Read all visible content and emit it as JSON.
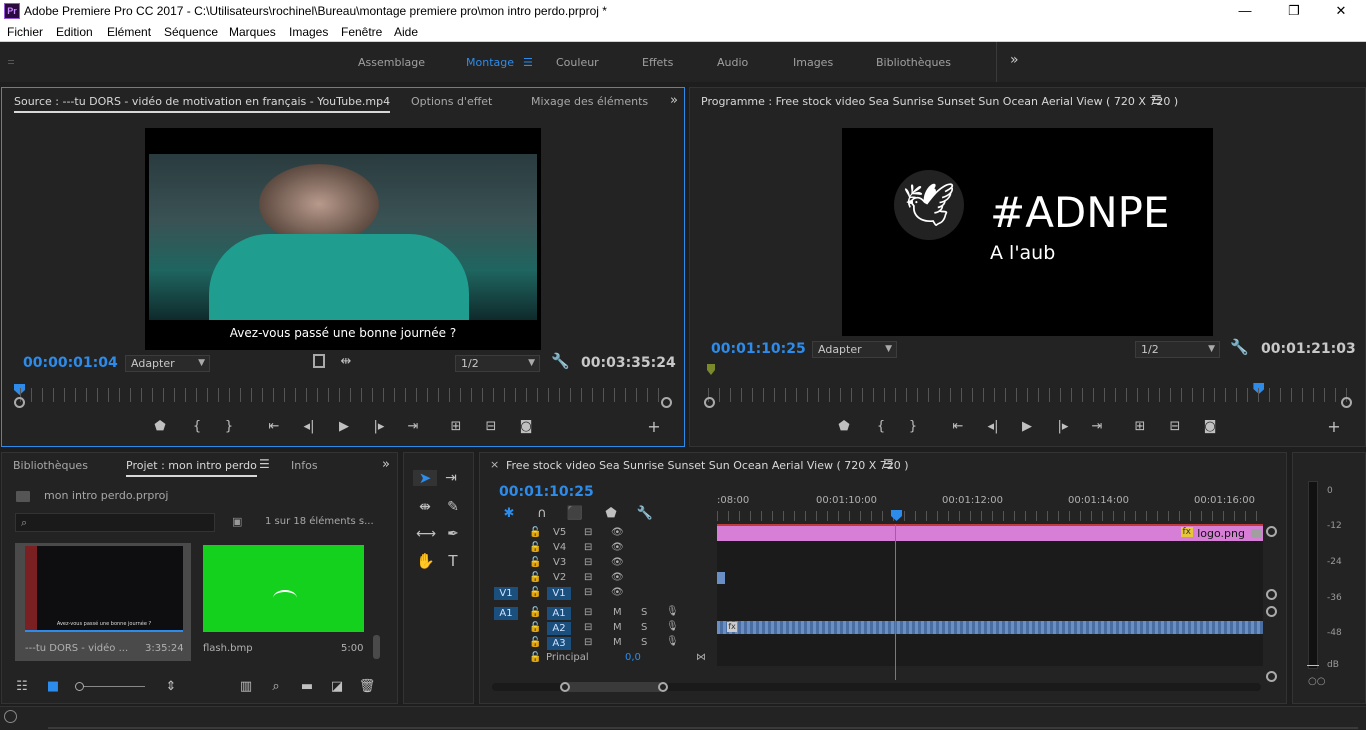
{
  "window": {
    "title": "Adobe Premiere Pro CC 2017 - C:\\Utilisateurs\\rochinel\\Bureau\\montage premiere pro\\mon intro perdo.prproj *",
    "app_icon": "Pr",
    "minimize": "—",
    "maximize": "❐",
    "close": "✕"
  },
  "menu": [
    "Fichier",
    "Edition",
    "Elément",
    "Séquence",
    "Marques",
    "Images",
    "Fenêtre",
    "Aide"
  ],
  "workspaces": {
    "items": [
      "Assemblage",
      "Montage",
      "Couleur",
      "Effets",
      "Audio",
      "Images",
      "Bibliothèques"
    ],
    "active": "Montage",
    "more": "»",
    "active_color": "#2d8ceb"
  },
  "source": {
    "tabs": [
      "Source : ---tu DORS - vidéo de motivation en français - YouTube.mp4",
      "Options d'effet",
      "Mixage des éléments a"
    ],
    "subtitle": "Avez-vous passé une bonne journée ?",
    "timecode": "00:00:01:04",
    "zoom": "Adapter",
    "resolution": "1/2",
    "duration": "00:03:35:24",
    "playhead_fraction": 0.0
  },
  "program": {
    "title": "Programme : Free stock video Sea Sunrise Sunset Sun Ocean Aerial View ( 720 X 720 )",
    "logo_text": "#ADNPE",
    "logo_sub": "A l'aub",
    "timecode": "00:01:10:25",
    "zoom": "Adapter",
    "resolution": "1/2",
    "duration": "00:01:21:03",
    "playhead_fraction": 0.86
  },
  "project": {
    "tabs": [
      "Bibliothèques",
      "Projet : mon intro perdo",
      "Infos"
    ],
    "file": "mon intro perdo.prproj",
    "search_placeholder": "",
    "count": "1 sur 18 éléments s...",
    "items": [
      {
        "name": "---tu DORS - vidéo ...",
        "duration": "3:35:24",
        "caption": "Avez-vous passé une bonne journée ?"
      },
      {
        "name": "flash.bmp",
        "duration": "5:00"
      }
    ]
  },
  "timeline": {
    "title": "Free stock video Sea Sunrise Sunset Sun Ocean Aerial View ( 720 X 720 )",
    "timecode": "00:01:10:25",
    "ruler_labels": [
      ":08:00",
      "00:01:10:00",
      "00:01:12:00",
      "00:01:14:00",
      "00:01:16:00"
    ],
    "video_tracks": [
      "V5",
      "V4",
      "V3",
      "V2",
      "V1"
    ],
    "audio_tracks": [
      "A1",
      "A2",
      "A3"
    ],
    "source_patch_v": "V1",
    "source_patch_a": "A1",
    "mute": "M",
    "solo": "S",
    "master_label": "Principal",
    "master_value": "0,0",
    "clip_logo": "logo.png",
    "clip_fx": "fx",
    "clip_color_pink": "#d77ed7",
    "clip_color_audio": "#6a8fc4"
  },
  "meter": {
    "scale": [
      "0",
      "-12",
      "-24",
      "-36",
      "-48",
      "dB"
    ],
    "solo_btns": "○○"
  }
}
